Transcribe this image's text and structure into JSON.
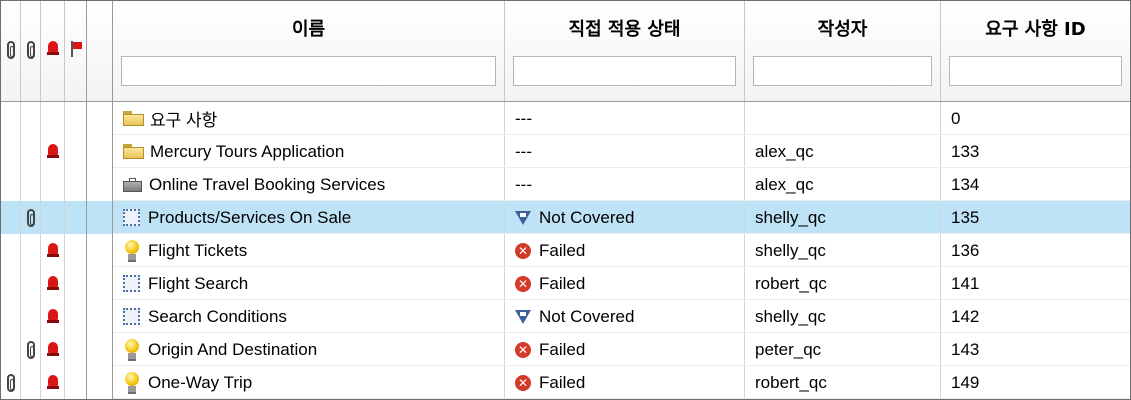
{
  "columns": {
    "attach1_icon": "attachment-icon",
    "attach2_icon": "attachment-icon",
    "alert_icon": "alert-icon",
    "flag_icon": "flag-icon",
    "name": "이름",
    "direct_cover_status": "직접 적용 상태",
    "author": "작성자",
    "req_id": "요구 사항 ID"
  },
  "filters": {
    "name": "",
    "direct_cover_status": "",
    "author": "",
    "req_id": ""
  },
  "rows": [
    {
      "attach1": false,
      "attach2": false,
      "alert": false,
      "flag": false,
      "type_icon": "folder-icon",
      "name": "요구 사항",
      "status_icon": "",
      "status": "---",
      "author": "",
      "req_id": "0",
      "selected": false
    },
    {
      "attach1": false,
      "attach2": false,
      "alert": true,
      "flag": false,
      "type_icon": "folder-icon",
      "name": "Mercury Tours Application",
      "status_icon": "",
      "status": "---",
      "author": "alex_qc",
      "req_id": "133",
      "selected": false
    },
    {
      "attach1": false,
      "attach2": false,
      "alert": false,
      "flag": false,
      "type_icon": "briefcase-icon",
      "name": "Online Travel Booking Services",
      "status_icon": "",
      "status": "---",
      "author": "alex_qc",
      "req_id": "134",
      "selected": false
    },
    {
      "attach1": false,
      "attach2": true,
      "alert": false,
      "flag": false,
      "type_icon": "undefined-req-icon",
      "name": "Products/Services On Sale",
      "status_icon": "not-covered-icon",
      "status": "Not Covered",
      "author": "shelly_qc",
      "req_id": "135",
      "selected": true
    },
    {
      "attach1": false,
      "attach2": false,
      "alert": true,
      "flag": false,
      "type_icon": "bulb-icon",
      "name": "Flight Tickets",
      "status_icon": "failed-icon",
      "status": "Failed",
      "author": "shelly_qc",
      "req_id": "136",
      "selected": false
    },
    {
      "attach1": false,
      "attach2": false,
      "alert": true,
      "flag": false,
      "type_icon": "undefined-req-icon",
      "name": "Flight Search",
      "status_icon": "failed-icon",
      "status": "Failed",
      "author": "robert_qc",
      "req_id": "141",
      "selected": false
    },
    {
      "attach1": false,
      "attach2": false,
      "alert": true,
      "flag": false,
      "type_icon": "undefined-req-icon",
      "name": "Search Conditions",
      "status_icon": "not-covered-icon",
      "status": "Not Covered",
      "author": "shelly_qc",
      "req_id": "142",
      "selected": false
    },
    {
      "attach1": false,
      "attach2": true,
      "alert": true,
      "flag": false,
      "type_icon": "bulb-icon",
      "name": "Origin And Destination",
      "status_icon": "failed-icon",
      "status": "Failed",
      "author": "peter_qc",
      "req_id": "143",
      "selected": false
    },
    {
      "attach1": true,
      "attach2": false,
      "alert": true,
      "flag": false,
      "type_icon": "bulb-icon",
      "name": "One-Way Trip",
      "status_icon": "failed-icon",
      "status": "Failed",
      "author": "robert_qc",
      "req_id": "149",
      "selected": false
    }
  ]
}
